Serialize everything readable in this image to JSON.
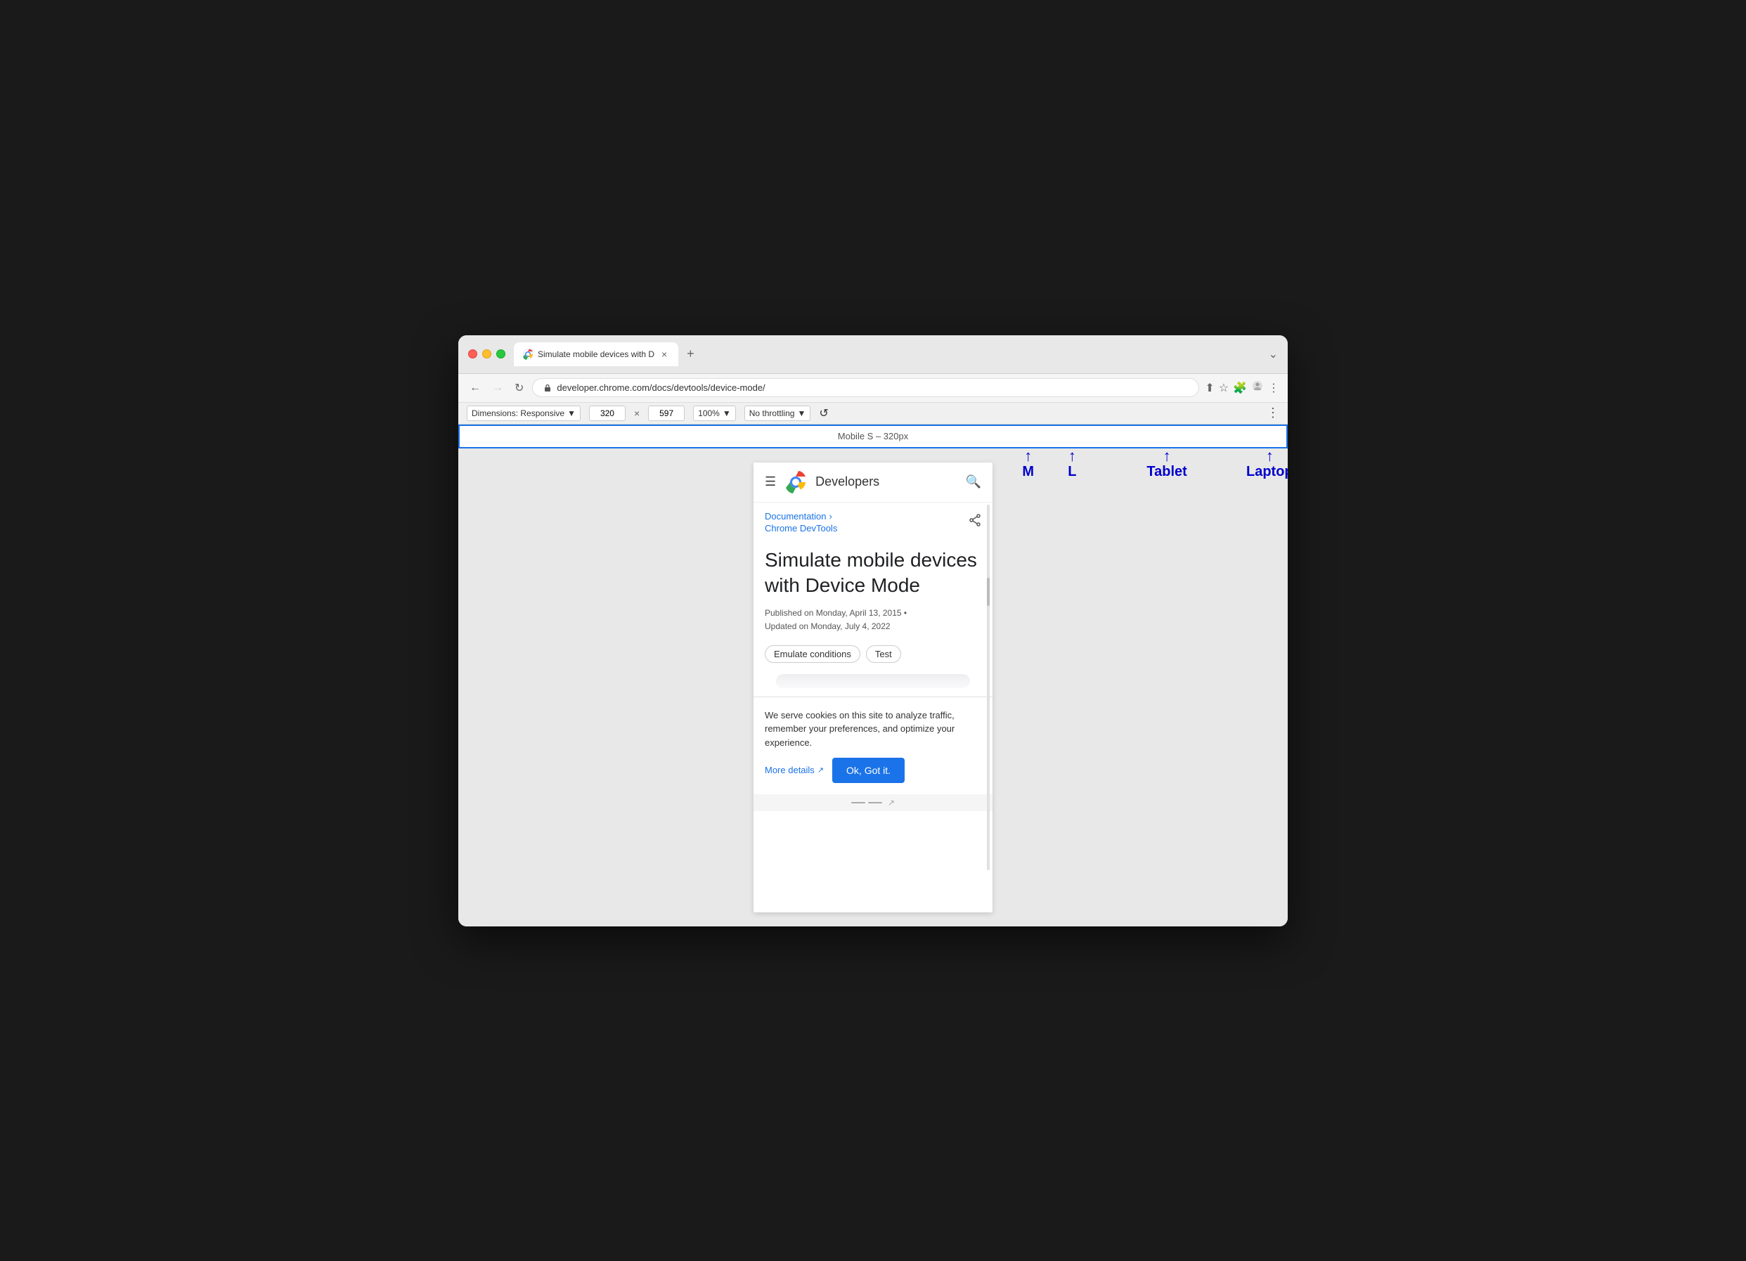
{
  "browser": {
    "traffic_lights": [
      "red",
      "yellow",
      "green"
    ],
    "tab": {
      "title": "Simulate mobile devices with D",
      "close_label": "×"
    },
    "new_tab_label": "+",
    "window_controls": "⌄",
    "nav": {
      "back_label": "←",
      "forward_label": "→",
      "reload_label": "↻",
      "url": "developer.chrome.com/docs/devtools/device-mode/",
      "share_icon": "⬆",
      "star_icon": "☆",
      "extension_icon": "🧩",
      "profile_icon": "👤",
      "more_icon": "⋮"
    },
    "devtools": {
      "dimensions_label": "Dimensions: Responsive",
      "width_value": "320",
      "height_value": "597",
      "multiply_sign": "×",
      "zoom_label": "100%",
      "throttle_label": "No throttling",
      "rotate_icon": "↺",
      "more_icon": "⋮"
    },
    "device_bar": {
      "label": "Mobile S – 320px"
    },
    "arrows": [
      {
        "label": "M",
        "position_pct": 71
      },
      {
        "label": "L",
        "position_pct": 76
      },
      {
        "label": "Tablet",
        "position_pct": 86
      },
      {
        "label": "Laptop",
        "position_pct": 98
      }
    ]
  },
  "page": {
    "header": {
      "hamburger": "☰",
      "brand": "Developers",
      "search": "🔍"
    },
    "breadcrumb": {
      "doc_link": "Documentation",
      "doc_arrow": "›",
      "sublink": "Chrome DevTools"
    },
    "article": {
      "title": "Simulate mobile devices with Device Mode",
      "published": "Published on Monday, April 13, 2015 •",
      "updated": "Updated on Monday, July 4, 2022",
      "tags": [
        "Emulate conditions",
        "Test"
      ]
    },
    "cookie_banner": {
      "text": "We serve cookies on this site to analyze traffic, remember your preferences, and optimize your experience.",
      "more_details_label": "More details",
      "external_icon": "↗",
      "ok_button_label": "Ok, Got it."
    }
  }
}
